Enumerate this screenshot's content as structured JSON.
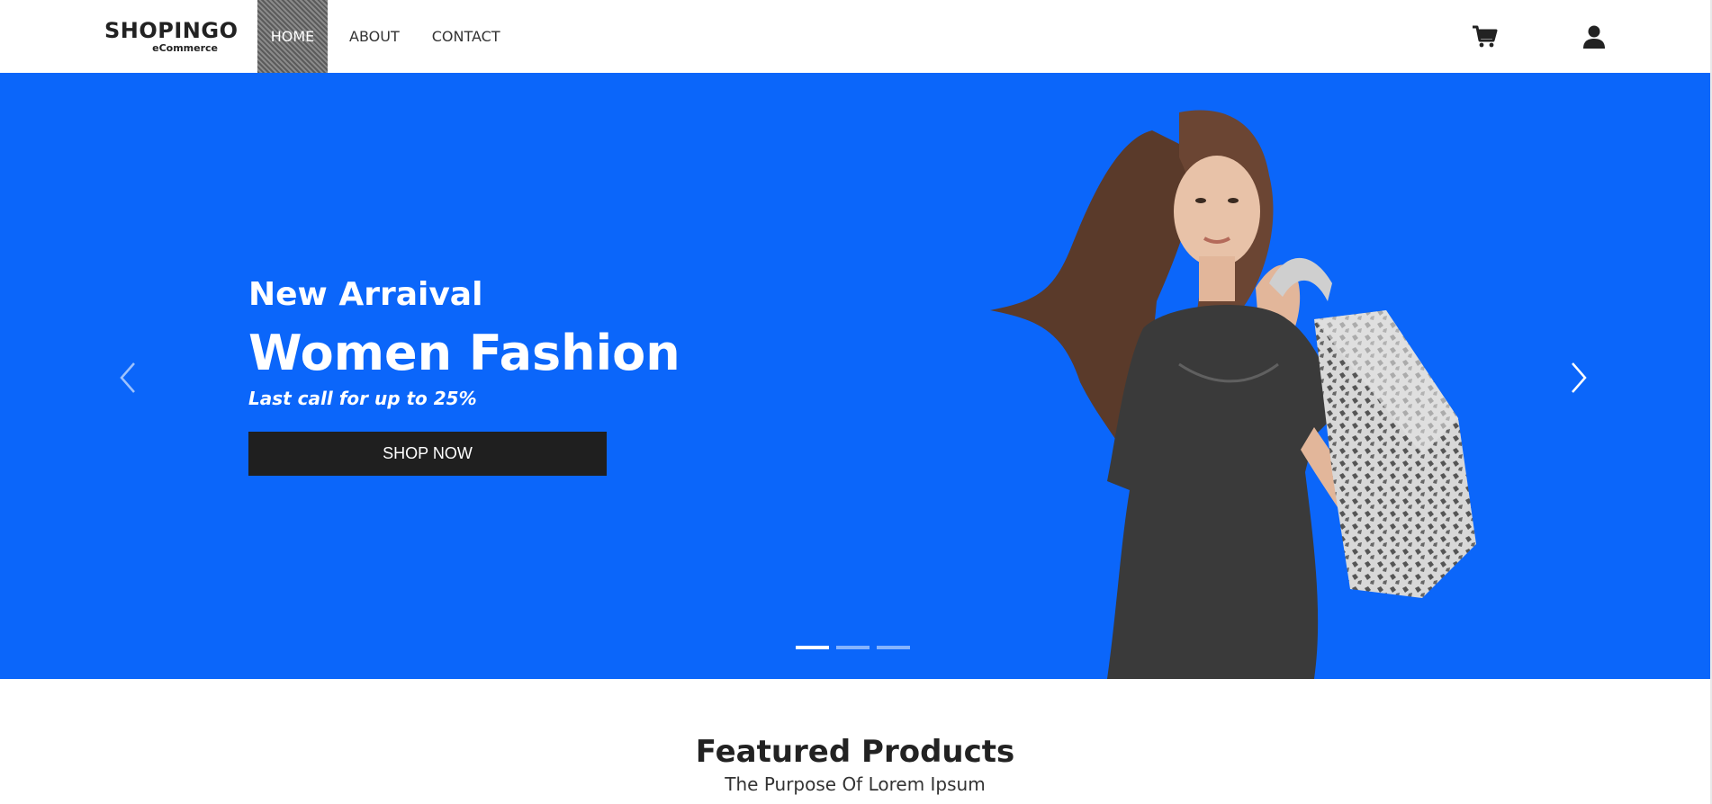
{
  "brand": {
    "name": "SHOPINGO",
    "tagline": "eCommerce"
  },
  "nav": {
    "links": [
      {
        "label": "HOME",
        "active": true
      },
      {
        "label": "ABOUT",
        "active": false
      },
      {
        "label": "CONTACT",
        "active": false
      }
    ],
    "icons": [
      "cart-icon",
      "user-icon"
    ]
  },
  "hero": {
    "subtitle": "New Arraival",
    "title": "Women Fashion",
    "tagline": "Last call for up to 25%",
    "button_label": "SHOP NOW",
    "slide_count": 3,
    "active_slide": 1,
    "colors": {
      "background": "#0b66fa",
      "button": "#1f1f1f"
    }
  },
  "featured": {
    "title": "Featured Products",
    "subtitle": "The Purpose Of Lorem Ipsum"
  }
}
